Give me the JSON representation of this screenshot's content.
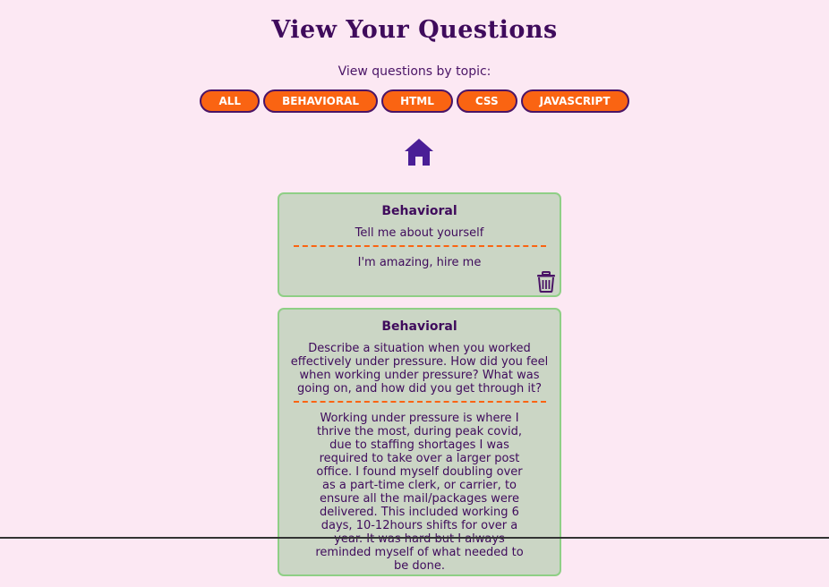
{
  "header": {
    "title": "View Your Questions",
    "topic_prompt": "View questions by topic:"
  },
  "topics": [
    {
      "label": "ALL"
    },
    {
      "label": "BEHAVIORAL"
    },
    {
      "label": "HTML"
    },
    {
      "label": "CSS"
    },
    {
      "label": "JAVASCRIPT"
    }
  ],
  "nav": {
    "home_icon": "home-icon"
  },
  "cards": [
    {
      "topic": "Behavioral",
      "question": "Tell me about yourself",
      "answer": "I'm amazing, hire me",
      "delete_icon": "trash-icon"
    },
    {
      "topic": "Behavioral",
      "question": "Describe a situation when you worked effectively under pressure. How did you feel when working under pressure? What was going on, and how did you get through it?",
      "answer": "Working under pressure is where I thrive the most, during peak covid, due to staffing shortages I was required to take over a larger post office. I found myself doubling over as a part-time clerk, or carrier, to ensure all the mail/packages were delivered. This included working 6 days, 10-12hours shifts for over a year. It was hard but I always reminded myself of what needed to be done."
    }
  ],
  "colors": {
    "background": "#fce8f3",
    "accent": "#fa6412",
    "text": "#4a1466",
    "card_bg": "#cbd6c5",
    "card_border": "#8fcf86"
  }
}
